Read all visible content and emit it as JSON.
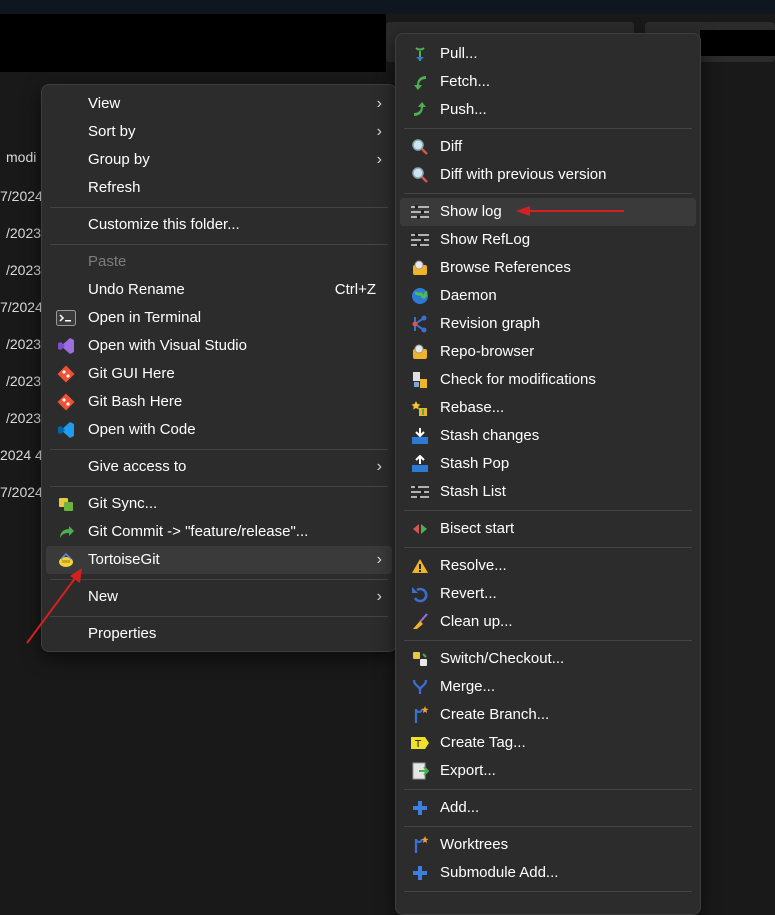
{
  "background_dates": [
    "modi",
    "7/2024",
    "/2023",
    "/2023",
    "7/2024",
    "/2023",
    "/2023",
    "/2023",
    "2024 4",
    "7/2024"
  ],
  "main_menu": {
    "items": [
      {
        "label": "View"
      },
      {
        "label": "Sort by"
      },
      {
        "label": "Group by"
      },
      {
        "label": "Refresh"
      },
      {
        "label": "Customize this folder..."
      },
      {
        "label": "Paste"
      },
      {
        "label": "Undo Rename",
        "shortcut": "Ctrl+Z"
      },
      {
        "label": "Open in Terminal"
      },
      {
        "label": "Open with Visual Studio"
      },
      {
        "label": "Git GUI Here"
      },
      {
        "label": "Git Bash Here"
      },
      {
        "label": "Open with Code"
      },
      {
        "label": "Give access to"
      },
      {
        "label": "Git Sync..."
      },
      {
        "label": "Git Commit -> \"feature/release\"..."
      },
      {
        "label": "TortoiseGit"
      },
      {
        "label": "New"
      },
      {
        "label": "Properties"
      }
    ]
  },
  "sub_menu": {
    "items": [
      {
        "label": "Pull..."
      },
      {
        "label": "Fetch..."
      },
      {
        "label": "Push..."
      },
      {
        "label": "Diff"
      },
      {
        "label": "Diff with previous version"
      },
      {
        "label": "Show log"
      },
      {
        "label": "Show RefLog"
      },
      {
        "label": "Browse References"
      },
      {
        "label": "Daemon"
      },
      {
        "label": "Revision graph"
      },
      {
        "label": "Repo-browser"
      },
      {
        "label": "Check for modifications"
      },
      {
        "label": "Rebase..."
      },
      {
        "label": "Stash changes"
      },
      {
        "label": "Stash Pop"
      },
      {
        "label": "Stash List"
      },
      {
        "label": "Bisect start"
      },
      {
        "label": "Resolve..."
      },
      {
        "label": "Revert..."
      },
      {
        "label": "Clean up..."
      },
      {
        "label": "Switch/Checkout..."
      },
      {
        "label": "Merge..."
      },
      {
        "label": "Create Branch..."
      },
      {
        "label": "Create Tag..."
      },
      {
        "label": "Export..."
      },
      {
        "label": "Add..."
      },
      {
        "label": "Worktrees"
      },
      {
        "label": "Submodule Add..."
      }
    ]
  },
  "colors": {
    "menu_bg": "#2c2c2c",
    "highlight": "#3a3a3a",
    "annotation_arrow": "#d42020",
    "disabled_text": "#7c7c7c"
  }
}
